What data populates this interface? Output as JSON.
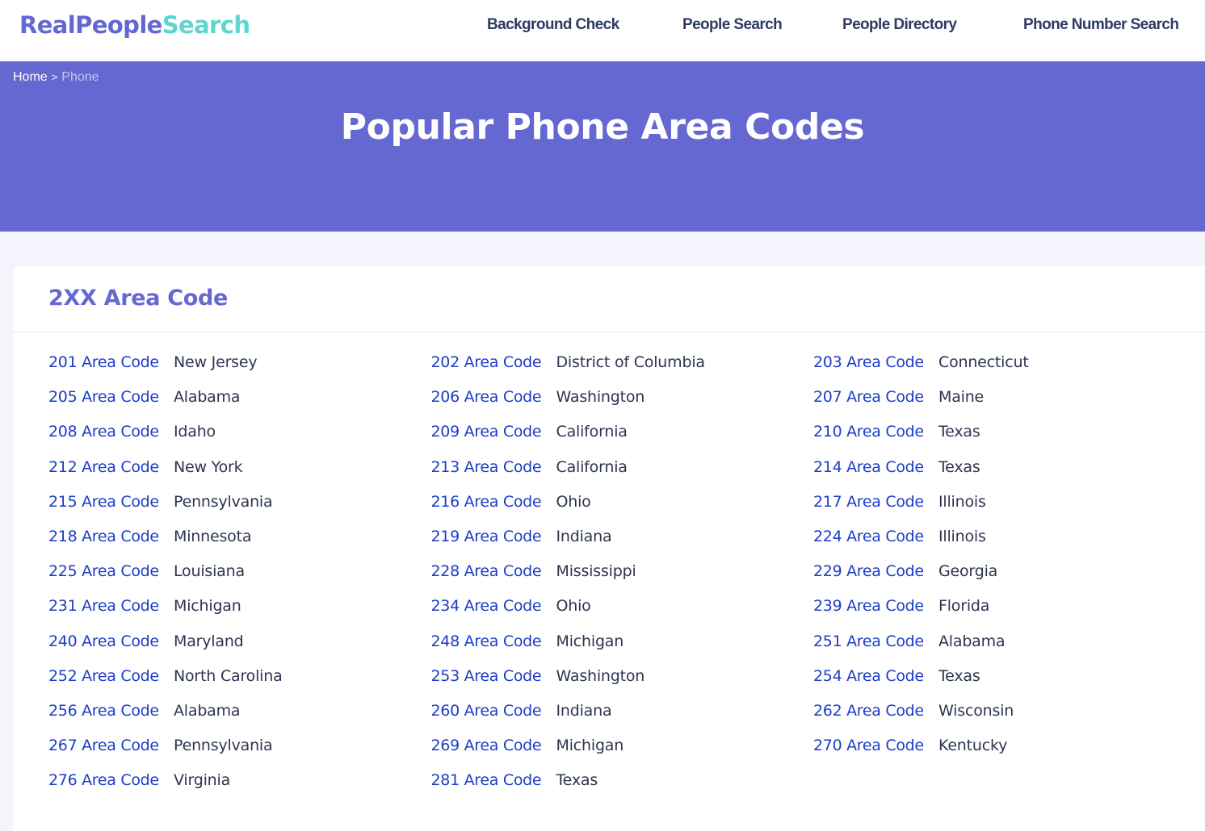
{
  "header": {
    "logo_part1": "RealPeople",
    "logo_part2": "Search",
    "nav": [
      {
        "label": "Background Check"
      },
      {
        "label": "People Search"
      },
      {
        "label": "People Directory"
      },
      {
        "label": "Phone Number Search"
      }
    ]
  },
  "breadcrumb": {
    "home": "Home",
    "separator": ">",
    "current": "Phone"
  },
  "hero": {
    "title": "Popular Phone Area Codes"
  },
  "section": {
    "title": "2XX Area Code",
    "entries": [
      {
        "code": "201 Area Code",
        "state": "New Jersey"
      },
      {
        "code": "202 Area Code",
        "state": "District of Columbia"
      },
      {
        "code": "203 Area Code",
        "state": "Connecticut"
      },
      {
        "code": "205 Area Code",
        "state": "Alabama"
      },
      {
        "code": "206 Area Code",
        "state": "Washington"
      },
      {
        "code": "207 Area Code",
        "state": "Maine"
      },
      {
        "code": "208 Area Code",
        "state": "Idaho"
      },
      {
        "code": "209 Area Code",
        "state": "California"
      },
      {
        "code": "210 Area Code",
        "state": "Texas"
      },
      {
        "code": "212 Area Code",
        "state": "New York"
      },
      {
        "code": "213 Area Code",
        "state": "California"
      },
      {
        "code": "214 Area Code",
        "state": "Texas"
      },
      {
        "code": "215 Area Code",
        "state": "Pennsylvania"
      },
      {
        "code": "216 Area Code",
        "state": "Ohio"
      },
      {
        "code": "217 Area Code",
        "state": "Illinois"
      },
      {
        "code": "218 Area Code",
        "state": "Minnesota"
      },
      {
        "code": "219 Area Code",
        "state": "Indiana"
      },
      {
        "code": "224 Area Code",
        "state": "Illinois"
      },
      {
        "code": "225 Area Code",
        "state": "Louisiana"
      },
      {
        "code": "228 Area Code",
        "state": "Mississippi"
      },
      {
        "code": "229 Area Code",
        "state": "Georgia"
      },
      {
        "code": "231 Area Code",
        "state": "Michigan"
      },
      {
        "code": "234 Area Code",
        "state": "Ohio"
      },
      {
        "code": "239 Area Code",
        "state": "Florida"
      },
      {
        "code": "240 Area Code",
        "state": "Maryland"
      },
      {
        "code": "248 Area Code",
        "state": "Michigan"
      },
      {
        "code": "251 Area Code",
        "state": "Alabama"
      },
      {
        "code": "252 Area Code",
        "state": "North Carolina"
      },
      {
        "code": "253 Area Code",
        "state": "Washington"
      },
      {
        "code": "254 Area Code",
        "state": "Texas"
      },
      {
        "code": "256 Area Code",
        "state": "Alabama"
      },
      {
        "code": "260 Area Code",
        "state": "Indiana"
      },
      {
        "code": "262 Area Code",
        "state": "Wisconsin"
      },
      {
        "code": "267 Area Code",
        "state": "Pennsylvania"
      },
      {
        "code": "269 Area Code",
        "state": "Michigan"
      },
      {
        "code": "270 Area Code",
        "state": "Kentucky"
      },
      {
        "code": "276 Area Code",
        "state": "Virginia"
      },
      {
        "code": "281 Area Code",
        "state": "Texas"
      }
    ]
  }
}
